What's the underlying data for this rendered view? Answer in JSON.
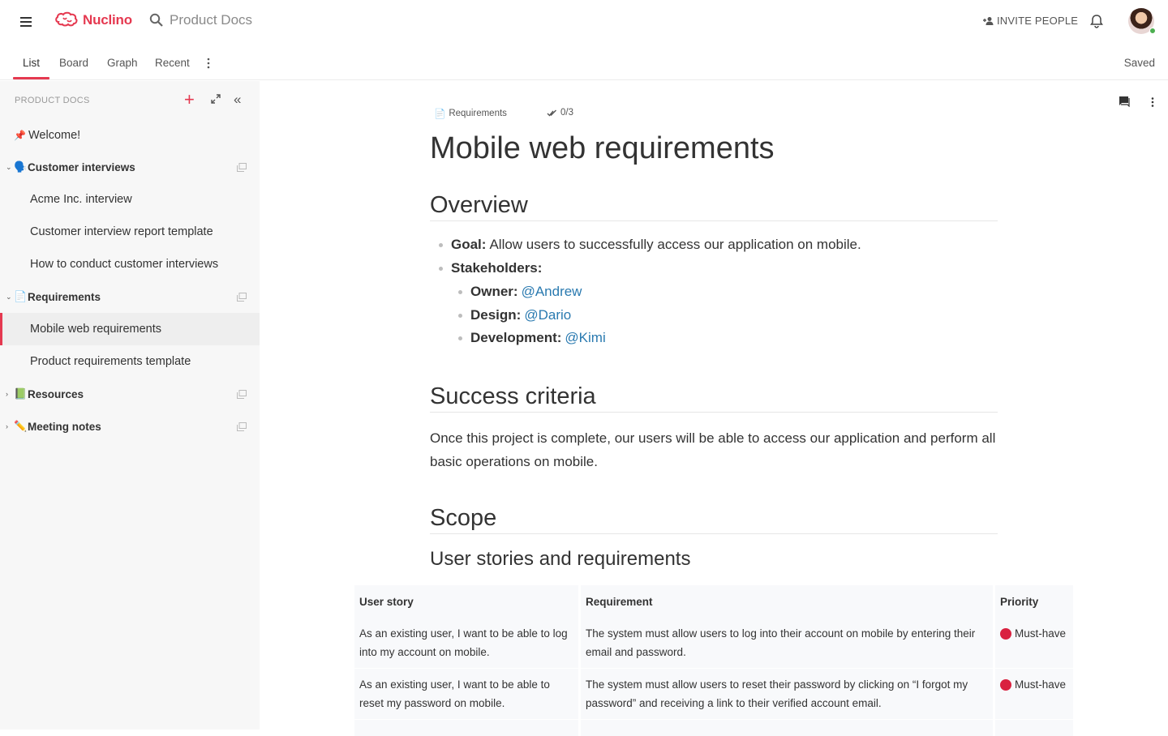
{
  "app": {
    "brand": "Nuclino",
    "brand_color": "#e53950"
  },
  "search": {
    "workspace": "Product Docs"
  },
  "header": {
    "invite_label": "INVITE PEOPLE"
  },
  "tabs": [
    {
      "label": "List",
      "active": true
    },
    {
      "label": "Board"
    },
    {
      "label": "Graph"
    },
    {
      "label": "Recent"
    }
  ],
  "status": {
    "saved": "Saved"
  },
  "sidebar": {
    "header": "PRODUCT DOCS",
    "pinned": {
      "label": "Welcome!",
      "icon": "pin-icon"
    },
    "groups": [
      {
        "emoji": "🗣️",
        "label": "Customer interviews",
        "expanded": true,
        "children": [
          "Acme Inc. interview",
          "Customer interview report template",
          "How to conduct customer interviews"
        ]
      },
      {
        "emoji": "📄",
        "label": "Requirements",
        "expanded": true,
        "children": [
          "Mobile web requirements",
          "Product requirements template"
        ]
      },
      {
        "emoji": "📗",
        "label": "Resources",
        "expanded": false
      },
      {
        "emoji": "✏️",
        "label": "Meeting notes",
        "expanded": false
      }
    ],
    "selected": "Mobile web requirements"
  },
  "doc": {
    "breadcrumb": {
      "emoji": "📄",
      "label": "Requirements"
    },
    "tasks": "0/3",
    "title": "Mobile web requirements",
    "overview": {
      "heading": "Overview",
      "goal_label": "Goal:",
      "goal_text": "Allow users to successfully access our application on mobile.",
      "stakeholders_label": "Stakeholders:",
      "owner_label": "Owner:",
      "owner": "@Andrew",
      "design_label": "Design:",
      "design": "@Dario",
      "development_label": "Development:",
      "development": "@Kimi"
    },
    "success": {
      "heading": "Success criteria",
      "text": "Once this project is complete, our users will be able to access our application and perform all basic operations on mobile."
    },
    "scope": {
      "heading": "Scope",
      "subheading": "User stories and requirements"
    },
    "table": {
      "headers": [
        "User story",
        "Requirement",
        "Priority"
      ],
      "rows": [
        {
          "story": "As an existing user, I want to be able to log into my account on mobile.",
          "requirement": "The system must allow users to log into their account on mobile by entering their email and password.",
          "priority": "Must-have"
        },
        {
          "story": "As an existing user, I want to be able to reset my password on mobile.",
          "requirement": "The system must allow users to reset their password by clicking on  “I forgot my password” and receiving a link to their verified account email.",
          "priority": "Must-have"
        }
      ],
      "priority_color": "#d9213f"
    }
  }
}
